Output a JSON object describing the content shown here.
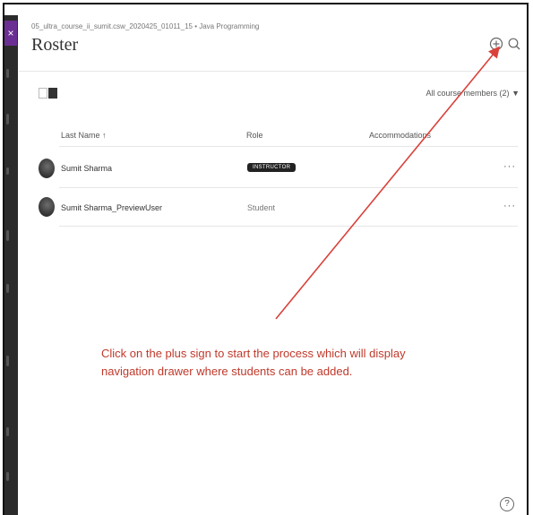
{
  "header": {
    "breadcrumb": "05_ultra_course_ii_sumit.csw_2020425_01011_15 • Java Programming",
    "title": "Roster",
    "close_glyph": "×"
  },
  "icons": {
    "add": "plus-circle-icon",
    "search": "search-icon",
    "help": "help-icon",
    "list_view": "list-view-icon",
    "grid_view": "grid-view-icon"
  },
  "toolbar": {
    "filter_label": "All course members (2)",
    "filter_caret": "▼"
  },
  "table": {
    "columns": [
      "Last Name ↑",
      "Role",
      "Accommodations"
    ],
    "rows": [
      {
        "name": "Sumit Sharma",
        "role": "INSTRUCTOR",
        "role_style": "badge",
        "more": "···"
      },
      {
        "name": "Sumit Sharma_PreviewUser",
        "role": "Student",
        "role_style": "text",
        "more": "···"
      }
    ]
  },
  "annotation": {
    "text": "Click on the plus sign to start the process which will display navigation drawer where students can be added.",
    "color": "#c0392b"
  },
  "help_glyph": "?",
  "colors": {
    "accent_purple": "#6b2f93",
    "badge_bg": "#222222",
    "arrow_red": "#d9413a"
  }
}
